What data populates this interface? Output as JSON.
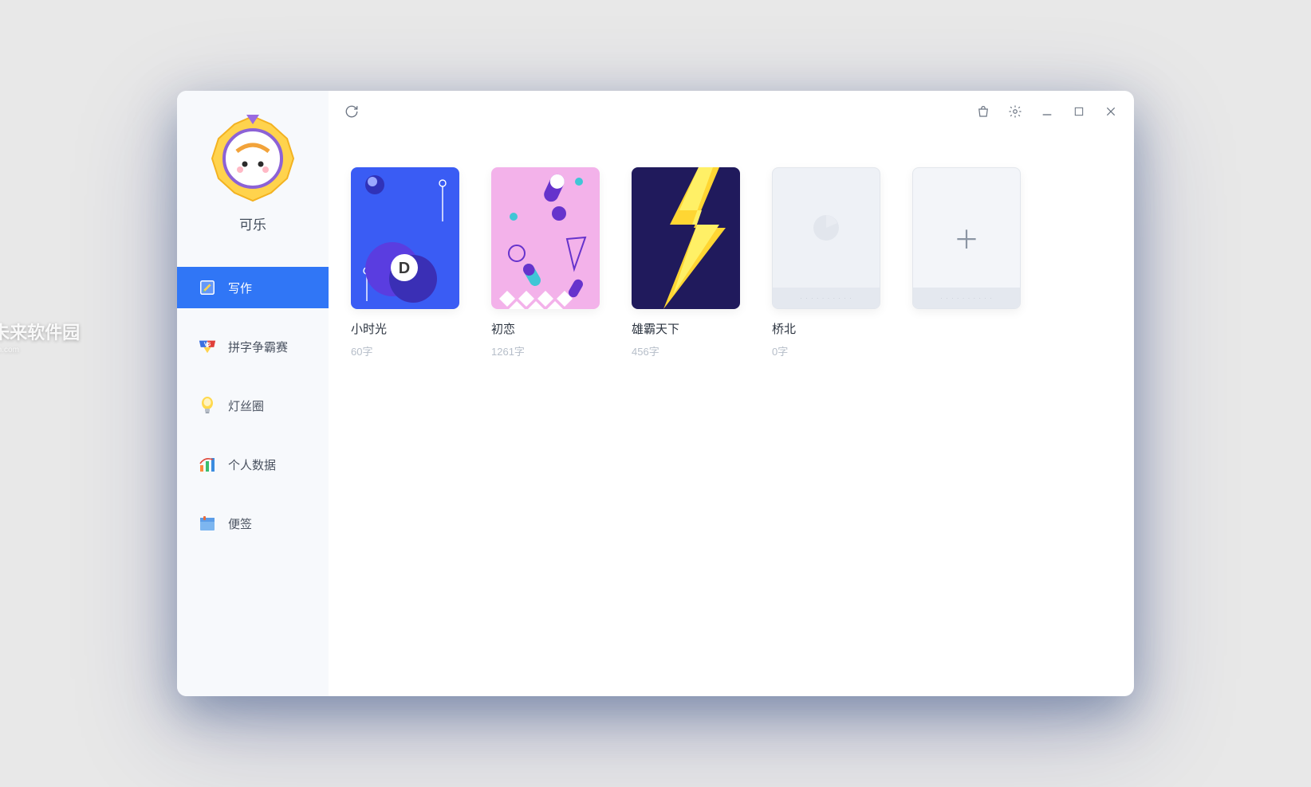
{
  "user": {
    "name": "可乐"
  },
  "nav": [
    {
      "id": "write",
      "label": "写作",
      "active": true
    },
    {
      "id": "contest",
      "label": "拼字争霸赛",
      "active": false
    },
    {
      "id": "circle",
      "label": "灯丝圈",
      "active": false
    },
    {
      "id": "stats",
      "label": "个人数据",
      "active": false
    },
    {
      "id": "notes",
      "label": "便签",
      "active": false
    }
  ],
  "books": [
    {
      "title": "小时光",
      "count": "60字"
    },
    {
      "title": "初恋",
      "count": "1261字"
    },
    {
      "title": "雄霸天下",
      "count": "456字"
    },
    {
      "title": "桥北",
      "count": "0字"
    }
  ],
  "watermark": {
    "line1": "未来软件园",
    "line2": "mac.orsoon.com"
  }
}
